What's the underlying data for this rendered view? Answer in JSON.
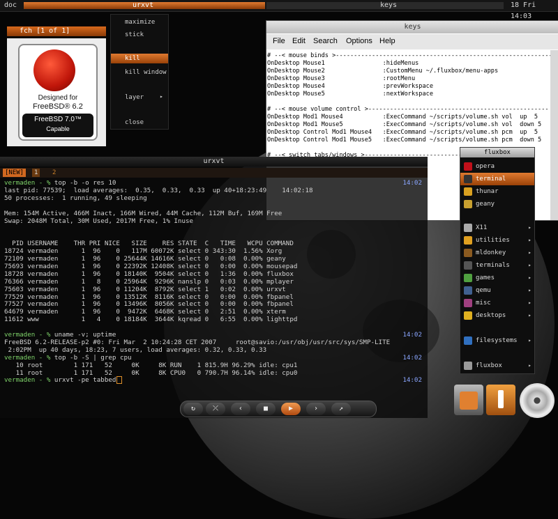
{
  "topbar": {
    "left_label": "doc",
    "win1_title": "urxvt",
    "win2_title": "keys",
    "clock": "18 Fri 14:03"
  },
  "fch_window": {
    "title": "fch [1 of 1]",
    "logo_line1": "Designed for",
    "logo_line2": "FreeBSD® 6.2",
    "logo_line3": "FreeBSD 7.0™",
    "logo_line4": "Capable"
  },
  "root_menu": {
    "items": [
      {
        "label": "maximize"
      },
      {
        "label": "stick"
      },
      {
        "label": "kill"
      },
      {
        "label": "kill window"
      },
      {
        "label": "layer"
      },
      {
        "label": "close"
      }
    ]
  },
  "keys_window": {
    "title": "keys",
    "menus": [
      "File",
      "Edit",
      "Search",
      "Options",
      "Help"
    ],
    "lines": [
      "# --< mouse binds >-------------------------------------------------------------",
      "OnDesktop Mouse1                :hideMenus",
      "OnDesktop Mouse2                :CustomMenu ~/.fluxbox/menu-apps",
      "OnDesktop Mouse3                :rootMenu",
      "OnDesktop Mouse4                :prevWorkspace",
      "OnDesktop Mouse5                :nextWorkspace",
      "",
      "# --< mouse volume control >--------------------------------------------------",
      "OnDesktop Mod1 Mouse4           :ExecCommand ~/scripts/volume.sh vol  up  5",
      "OnDesktop Mod1 Mouse5           :ExecCommand ~/scripts/volume.sh vol  down 5",
      "OnDesktop Control Mod1 Mouse4   :ExecCommand ~/scripts/volume.sh pcm  up  5",
      "OnDesktop Control Mod1 Mouse5   :ExecCommand ~/scripts/volume.sh pcm  down 5",
      "",
      "# --< switch tabs/windows >---------------------------------------",
      "",
      "",
      "",
      "",
      "                                                      orkspace"
    ]
  },
  "terminal": {
    "title": "urxvt",
    "tabs": [
      "[NEW]",
      "1",
      "2"
    ],
    "lines": [
      {
        "p": "vermaden - % ",
        "t": "top -b -o res 10",
        "ts": "14:02"
      },
      {
        "p": "",
        "t": "last pid: 77539;  load averages:  0.35,  0.33,  0.33  up 40+18:23:49    14:02:18"
      },
      {
        "p": "",
        "t": "50 processes:  1 running, 49 sleeping"
      },
      {
        "p": "",
        "t": ""
      },
      {
        "p": "",
        "t": "Mem: 154M Active, 466M Inact, 166M Wired, 44M Cache, 112M Buf, 169M Free"
      },
      {
        "p": "",
        "t": "Swap: 2048M Total, 30M Used, 2017M Free, 1% Inuse"
      },
      {
        "p": "",
        "t": ""
      },
      {
        "p": "",
        "t": ""
      },
      {
        "p": "",
        "t": "  PID USERNAME    THR PRI NICE   SIZE    RES STATE  C   TIME   WCPU COMMAND"
      },
      {
        "p": "",
        "t": "18724 vermaden      1  96    0   117M 60072K select 0 343:30  1.56% Xorg"
      },
      {
        "p": "",
        "t": "72109 vermaden      1  96    0 25644K 14616K select 0   0:08  0.00% geany"
      },
      {
        "p": "",
        "t": "75693 vermaden      1  96    0 22392K 12408K select 0   0:00  0.00% mousepad"
      },
      {
        "p": "",
        "t": "18728 vermaden      1  96    0 18140K  9504K select 0   1:36  0.00% fluxbox"
      },
      {
        "p": "",
        "t": "76366 vermaden      1   8    0 25964K  9296K nanslp 0   0:03  0.00% mplayer"
      },
      {
        "p": "",
        "t": "75603 vermaden      1  96    0 11204K  8792K select 1   0:02  0.00% urxvt"
      },
      {
        "p": "",
        "t": "77529 vermaden      1  96    0 13512K  8116K select 0   0:00  0.00% fbpanel"
      },
      {
        "p": "",
        "t": "77527 vermaden      1  96    0 13496K  8056K select 0   0:00  0.00% fbpanel"
      },
      {
        "p": "",
        "t": "64679 vermaden      1  96    0  9472K  6468K select 0   2:51  0.00% xterm"
      },
      {
        "p": "",
        "t": "11612 www           1   4    0 18184K  3644K kqread 0   6:55  0.00% lighttpd"
      },
      {
        "p": "",
        "t": ""
      },
      {
        "p": "vermaden - % ",
        "t": "uname -v; uptime",
        "ts": "14:02"
      },
      {
        "p": "",
        "t": "FreeBSD 6.2-RELEASE-p2 #0: Fri Mar  2 10:24:28 CET 2007     root@savio:/usr/obj/usr/src/sys/SMP-LITE"
      },
      {
        "p": "",
        "t": " 2:02PM  up 40 days, 18:23, 7 users, load averages: 0.32, 0.33, 0.33"
      },
      {
        "p": "vermaden - % ",
        "t": "top -b -S | grep cpu",
        "ts": "14:02"
      },
      {
        "p": "",
        "t": "   10 root        1 171   52     0K     8K RUN    1 815.9H 96.29% idle: cpu1"
      },
      {
        "p": "",
        "t": "   11 root        1 171   52     0K     8K CPU0   0 790.7H 96.14% idle: cpu0"
      },
      {
        "p": "vermaden - % ",
        "t": "urxvt -pe tabbed",
        "ts": "14:02"
      }
    ]
  },
  "fluxbox_menu": {
    "title": "fluxbox",
    "items": [
      {
        "label": "opera",
        "icon": "opera-icon",
        "color": "#c0101a",
        "sub": false
      },
      {
        "label": "terminal",
        "icon": "terminal-icon",
        "color": "#333333",
        "sub": false,
        "selected": true
      },
      {
        "label": "thunar",
        "icon": "thunar-icon",
        "color": "#d9a020",
        "sub": false
      },
      {
        "label": "geany",
        "icon": "geany-icon",
        "color": "#c8a030",
        "sub": false
      },
      {
        "label": "X11",
        "icon": "x11-icon",
        "color": "#aaaaaa",
        "sub": true
      },
      {
        "label": "utilities",
        "icon": "utilities-icon",
        "color": "#e0a020",
        "sub": true
      },
      {
        "label": "mldonkey",
        "icon": "mldonkey-icon",
        "color": "#8a5a20",
        "sub": true
      },
      {
        "label": "terminals",
        "icon": "terminals-icon",
        "color": "#555555",
        "sub": true
      },
      {
        "label": "games",
        "icon": "games-icon",
        "color": "#50a040",
        "sub": true
      },
      {
        "label": "qemu",
        "icon": "qemu-icon",
        "color": "#406090",
        "sub": true
      },
      {
        "label": "misc",
        "icon": "misc-icon",
        "color": "#a04080",
        "sub": true
      },
      {
        "label": "desktops",
        "icon": "desktops-icon",
        "color": "#e0b020",
        "sub": true
      },
      {
        "label": "filesystems",
        "icon": "filesystems-icon",
        "color": "#3070c0",
        "sub": true
      },
      {
        "label": "fluxbox",
        "icon": "fluxbox-icon",
        "color": "#999999",
        "sub": true
      }
    ]
  },
  "controls": {
    "buttons": [
      "↻",
      "⤫",
      "‹",
      "■",
      "▶",
      "›",
      "↗"
    ]
  }
}
